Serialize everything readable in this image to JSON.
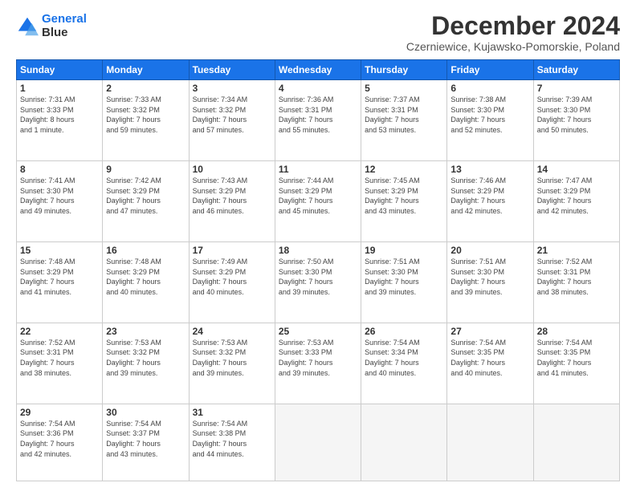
{
  "logo": {
    "line1": "General",
    "line2": "Blue"
  },
  "title": "December 2024",
  "subtitle": "Czerniewice, Kujawsko-Pomorskie, Poland",
  "days_header": [
    "Sunday",
    "Monday",
    "Tuesday",
    "Wednesday",
    "Thursday",
    "Friday",
    "Saturday"
  ],
  "weeks": [
    [
      {
        "day": "1",
        "info": "Sunrise: 7:31 AM\nSunset: 3:33 PM\nDaylight: 8 hours\nand 1 minute."
      },
      {
        "day": "2",
        "info": "Sunrise: 7:33 AM\nSunset: 3:32 PM\nDaylight: 7 hours\nand 59 minutes."
      },
      {
        "day": "3",
        "info": "Sunrise: 7:34 AM\nSunset: 3:32 PM\nDaylight: 7 hours\nand 57 minutes."
      },
      {
        "day": "4",
        "info": "Sunrise: 7:36 AM\nSunset: 3:31 PM\nDaylight: 7 hours\nand 55 minutes."
      },
      {
        "day": "5",
        "info": "Sunrise: 7:37 AM\nSunset: 3:31 PM\nDaylight: 7 hours\nand 53 minutes."
      },
      {
        "day": "6",
        "info": "Sunrise: 7:38 AM\nSunset: 3:30 PM\nDaylight: 7 hours\nand 52 minutes."
      },
      {
        "day": "7",
        "info": "Sunrise: 7:39 AM\nSunset: 3:30 PM\nDaylight: 7 hours\nand 50 minutes."
      }
    ],
    [
      {
        "day": "8",
        "info": "Sunrise: 7:41 AM\nSunset: 3:30 PM\nDaylight: 7 hours\nand 49 minutes."
      },
      {
        "day": "9",
        "info": "Sunrise: 7:42 AM\nSunset: 3:29 PM\nDaylight: 7 hours\nand 47 minutes."
      },
      {
        "day": "10",
        "info": "Sunrise: 7:43 AM\nSunset: 3:29 PM\nDaylight: 7 hours\nand 46 minutes."
      },
      {
        "day": "11",
        "info": "Sunrise: 7:44 AM\nSunset: 3:29 PM\nDaylight: 7 hours\nand 45 minutes."
      },
      {
        "day": "12",
        "info": "Sunrise: 7:45 AM\nSunset: 3:29 PM\nDaylight: 7 hours\nand 43 minutes."
      },
      {
        "day": "13",
        "info": "Sunrise: 7:46 AM\nSunset: 3:29 PM\nDaylight: 7 hours\nand 42 minutes."
      },
      {
        "day": "14",
        "info": "Sunrise: 7:47 AM\nSunset: 3:29 PM\nDaylight: 7 hours\nand 42 minutes."
      }
    ],
    [
      {
        "day": "15",
        "info": "Sunrise: 7:48 AM\nSunset: 3:29 PM\nDaylight: 7 hours\nand 41 minutes."
      },
      {
        "day": "16",
        "info": "Sunrise: 7:48 AM\nSunset: 3:29 PM\nDaylight: 7 hours\nand 40 minutes."
      },
      {
        "day": "17",
        "info": "Sunrise: 7:49 AM\nSunset: 3:29 PM\nDaylight: 7 hours\nand 40 minutes."
      },
      {
        "day": "18",
        "info": "Sunrise: 7:50 AM\nSunset: 3:30 PM\nDaylight: 7 hours\nand 39 minutes."
      },
      {
        "day": "19",
        "info": "Sunrise: 7:51 AM\nSunset: 3:30 PM\nDaylight: 7 hours\nand 39 minutes."
      },
      {
        "day": "20",
        "info": "Sunrise: 7:51 AM\nSunset: 3:30 PM\nDaylight: 7 hours\nand 39 minutes."
      },
      {
        "day": "21",
        "info": "Sunrise: 7:52 AM\nSunset: 3:31 PM\nDaylight: 7 hours\nand 38 minutes."
      }
    ],
    [
      {
        "day": "22",
        "info": "Sunrise: 7:52 AM\nSunset: 3:31 PM\nDaylight: 7 hours\nand 38 minutes."
      },
      {
        "day": "23",
        "info": "Sunrise: 7:53 AM\nSunset: 3:32 PM\nDaylight: 7 hours\nand 39 minutes."
      },
      {
        "day": "24",
        "info": "Sunrise: 7:53 AM\nSunset: 3:32 PM\nDaylight: 7 hours\nand 39 minutes."
      },
      {
        "day": "25",
        "info": "Sunrise: 7:53 AM\nSunset: 3:33 PM\nDaylight: 7 hours\nand 39 minutes."
      },
      {
        "day": "26",
        "info": "Sunrise: 7:54 AM\nSunset: 3:34 PM\nDaylight: 7 hours\nand 40 minutes."
      },
      {
        "day": "27",
        "info": "Sunrise: 7:54 AM\nSunset: 3:35 PM\nDaylight: 7 hours\nand 40 minutes."
      },
      {
        "day": "28",
        "info": "Sunrise: 7:54 AM\nSunset: 3:35 PM\nDaylight: 7 hours\nand 41 minutes."
      }
    ],
    [
      {
        "day": "29",
        "info": "Sunrise: 7:54 AM\nSunset: 3:36 PM\nDaylight: 7 hours\nand 42 minutes."
      },
      {
        "day": "30",
        "info": "Sunrise: 7:54 AM\nSunset: 3:37 PM\nDaylight: 7 hours\nand 43 minutes."
      },
      {
        "day": "31",
        "info": "Sunrise: 7:54 AM\nSunset: 3:38 PM\nDaylight: 7 hours\nand 44 minutes."
      },
      null,
      null,
      null,
      null
    ]
  ]
}
